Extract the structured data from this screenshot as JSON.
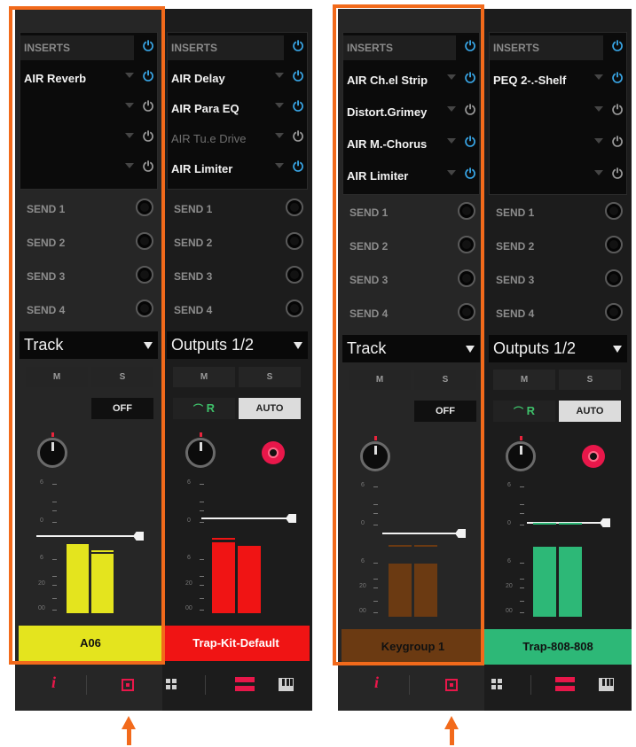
{
  "panels": [
    {
      "strips": [
        {
          "inserts_header": "INSERTS",
          "inserts": [
            {
              "name": "AIR Reverb",
              "power": "on"
            },
            {
              "name": "",
              "power": "off"
            },
            {
              "name": "",
              "power": "off"
            },
            {
              "name": "",
              "power": "off"
            }
          ],
          "sends": [
            "SEND 1",
            "SEND 2",
            "SEND 3",
            "SEND 4"
          ],
          "routing": "Track",
          "mute_label": "M",
          "solo_label": "S",
          "extra_button": "OFF",
          "scale": [
            "6",
            "0",
            "6",
            "20",
            "00"
          ],
          "track_name": "A06",
          "color": "#e4e41e"
        },
        {
          "inserts_header": "INSERTS",
          "inserts": [
            {
              "name": "AIR Delay",
              "power": "on"
            },
            {
              "name": "AIR Para EQ",
              "power": "on"
            },
            {
              "name": "AIR Tu.e Drive",
              "power": "off"
            },
            {
              "name": "AIR Limiter",
              "power": "on"
            }
          ],
          "sends": [
            "SEND 1",
            "SEND 2",
            "SEND 3",
            "SEND 4"
          ],
          "routing": "Outputs 1/2",
          "mute_label": "M",
          "solo_label": "S",
          "read_label": "R",
          "extra_button": "AUTO",
          "scale": [
            "6",
            "0",
            "6",
            "20",
            "00"
          ],
          "track_name": "Trap-Kit-Default",
          "color": "#f01414"
        }
      ]
    },
    {
      "strips": [
        {
          "inserts_header": "INSERTS",
          "inserts": [
            {
              "name": "AIR Ch.el Strip",
              "power": "on"
            },
            {
              "name": "Distort.Grimey",
              "power": "off"
            },
            {
              "name": "AIR M.-Chorus",
              "power": "on"
            },
            {
              "name": "AIR Limiter",
              "power": "on"
            }
          ],
          "sends": [
            "SEND 1",
            "SEND 2",
            "SEND 3",
            "SEND 4"
          ],
          "routing": "Track",
          "mute_label": "M",
          "solo_label": "S",
          "extra_button": "OFF",
          "scale": [
            "6",
            "0",
            "6",
            "20",
            "00"
          ],
          "track_name": "Keygroup 1",
          "color": "#6b3a12"
        },
        {
          "inserts_header": "INSERTS",
          "inserts": [
            {
              "name": "PEQ 2-.-Shelf",
              "power": "on"
            },
            {
              "name": "",
              "power": "off"
            },
            {
              "name": "",
              "power": "off"
            },
            {
              "name": "",
              "power": "off"
            }
          ],
          "sends": [
            "SEND 1",
            "SEND 2",
            "SEND 3",
            "SEND 4"
          ],
          "routing": "Outputs 1/2",
          "mute_label": "M",
          "solo_label": "S",
          "read_label": "R",
          "extra_button": "AUTO",
          "scale": [
            "6",
            "0",
            "6",
            "20",
            "00"
          ],
          "track_name": "Trap-808-808",
          "color": "#2db877"
        }
      ]
    }
  ],
  "toolbar": {
    "info_label": "i",
    "icons": [
      "info-icon",
      "single-channel-icon",
      "grid-icon",
      "rows-icon",
      "piano-icon"
    ]
  },
  "annotation_color": "#f26a1b"
}
